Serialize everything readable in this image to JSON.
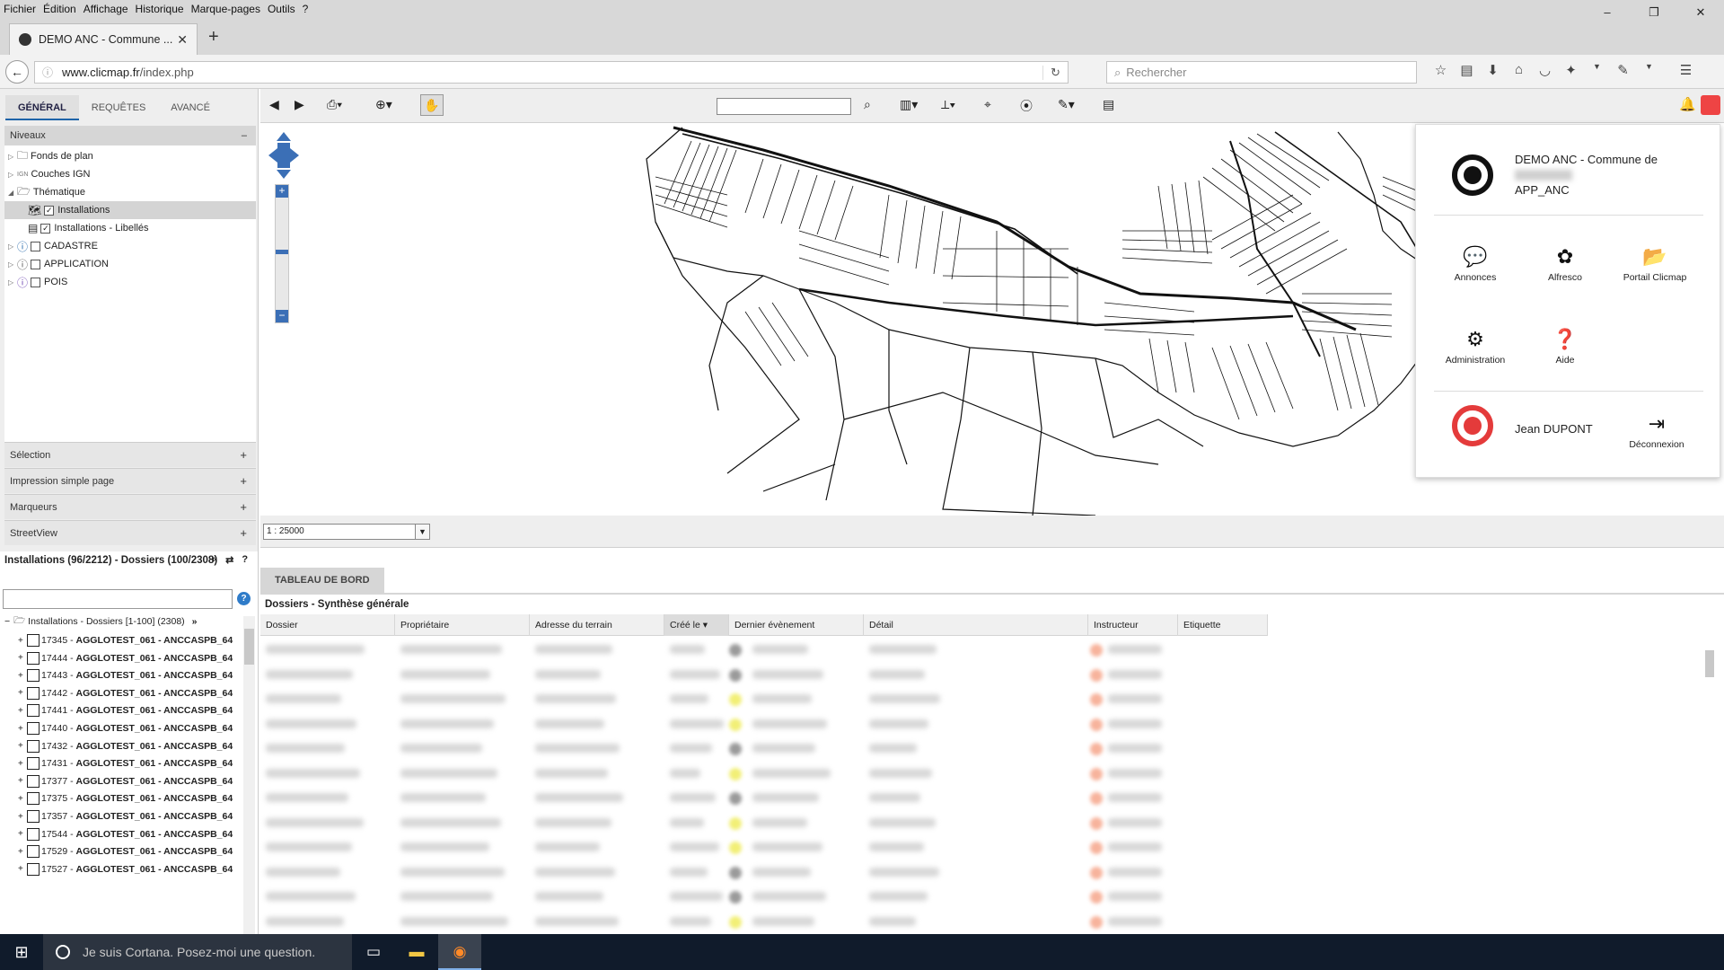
{
  "menubar": {
    "items": [
      "Fichier",
      "Édition",
      "Affichage",
      "Historique",
      "Marque-pages",
      "Outils",
      "?"
    ]
  },
  "window_controls": [
    "–",
    "❐",
    "✕"
  ],
  "tab": {
    "title": "DEMO ANC - Commune ...",
    "close": "✕",
    "new_tab": "+"
  },
  "navbar": {
    "url_domain": "www.clicmap.fr",
    "url_path": "/index.php",
    "search_placeholder": "Rechercher"
  },
  "left_panel": {
    "tabs": [
      "GÉNÉRAL",
      "REQUÊTES",
      "AVANCÉ"
    ],
    "niveaux_header": "Niveaux",
    "niveaux_toggle": "–",
    "tree": [
      "Fonds de plan",
      "Couches IGN",
      "Thématique",
      "Installations",
      "Installations - Libellés",
      "CADASTRE",
      "APPLICATION",
      "POIS"
    ],
    "accordions": [
      "Sélection",
      "Impression simple page",
      "Marqueurs",
      "StreetView"
    ],
    "accordion_toggle": "+"
  },
  "map": {
    "scale_value": "1 : 25000",
    "scale_arrow": "▼"
  },
  "app_menu": {
    "title_line1": "DEMO ANC - Commune de",
    "title_app": "APP_ANC",
    "items": [
      "Annonces",
      "Alfresco",
      "Portail Clicmap",
      "Administration",
      "Aide",
      "Déconnexion"
    ],
    "user_name": "Jean DUPONT"
  },
  "installations": {
    "title": "Installations (96/2212) - Dossiers (100/2308)",
    "controls": [
      "«",
      "⇄",
      "?"
    ],
    "help_label": "?",
    "root_label": "Installations - Dossiers [1-100] (2308)",
    "root_more": "»",
    "rows": [
      {
        "id": "17345",
        "name": "AGGLOTEST_061 - ANCCASPB_64"
      },
      {
        "id": "17444",
        "name": "AGGLOTEST_061 - ANCCASPB_64"
      },
      {
        "id": "17443",
        "name": "AGGLOTEST_061 - ANCCASPB_64"
      },
      {
        "id": "17442",
        "name": "AGGLOTEST_061 - ANCCASPB_64"
      },
      {
        "id": "17441",
        "name": "AGGLOTEST_061 - ANCCASPB_64"
      },
      {
        "id": "17440",
        "name": "AGGLOTEST_061 - ANCCASPB_64"
      },
      {
        "id": "17432",
        "name": "AGGLOTEST_061 - ANCCASPB_64"
      },
      {
        "id": "17431",
        "name": "AGGLOTEST_061 - ANCCASPB_64"
      },
      {
        "id": "17377",
        "name": "AGGLOTEST_061 - ANCCASPB_64"
      },
      {
        "id": "17375",
        "name": "AGGLOTEST_061 - ANCCASPB_64"
      },
      {
        "id": "17357",
        "name": "AGGLOTEST_061 - ANCCASPB_64"
      },
      {
        "id": "17544",
        "name": "AGGLOTEST_061 - ANCCASPB_64"
      },
      {
        "id": "17529",
        "name": "AGGLOTEST_061 - ANCCASPB_64"
      },
      {
        "id": "17527",
        "name": "AGGLOTEST_061 - ANCCASPB_64"
      }
    ]
  },
  "dashboard": {
    "tab": "TABLEAU DE BORD",
    "title": "Dossiers - Synthèse générale",
    "columns": [
      "Dossier",
      "Propriétaire",
      "Adresse du terrain",
      "Créé le",
      "Dernier évènement",
      "Détail",
      "Instructeur",
      "Etiquette"
    ],
    "sorted_column_arrow": "▾",
    "visible_rows": 12
  },
  "taskbar": {
    "cortana_text": "Je suis Cortana. Posez-moi une question."
  },
  "colors": {
    "accent": "#1d63a8",
    "user_avatar": "#e43b3b",
    "map_nav": "#3b6fb6",
    "taskbar": "#101b2b"
  }
}
